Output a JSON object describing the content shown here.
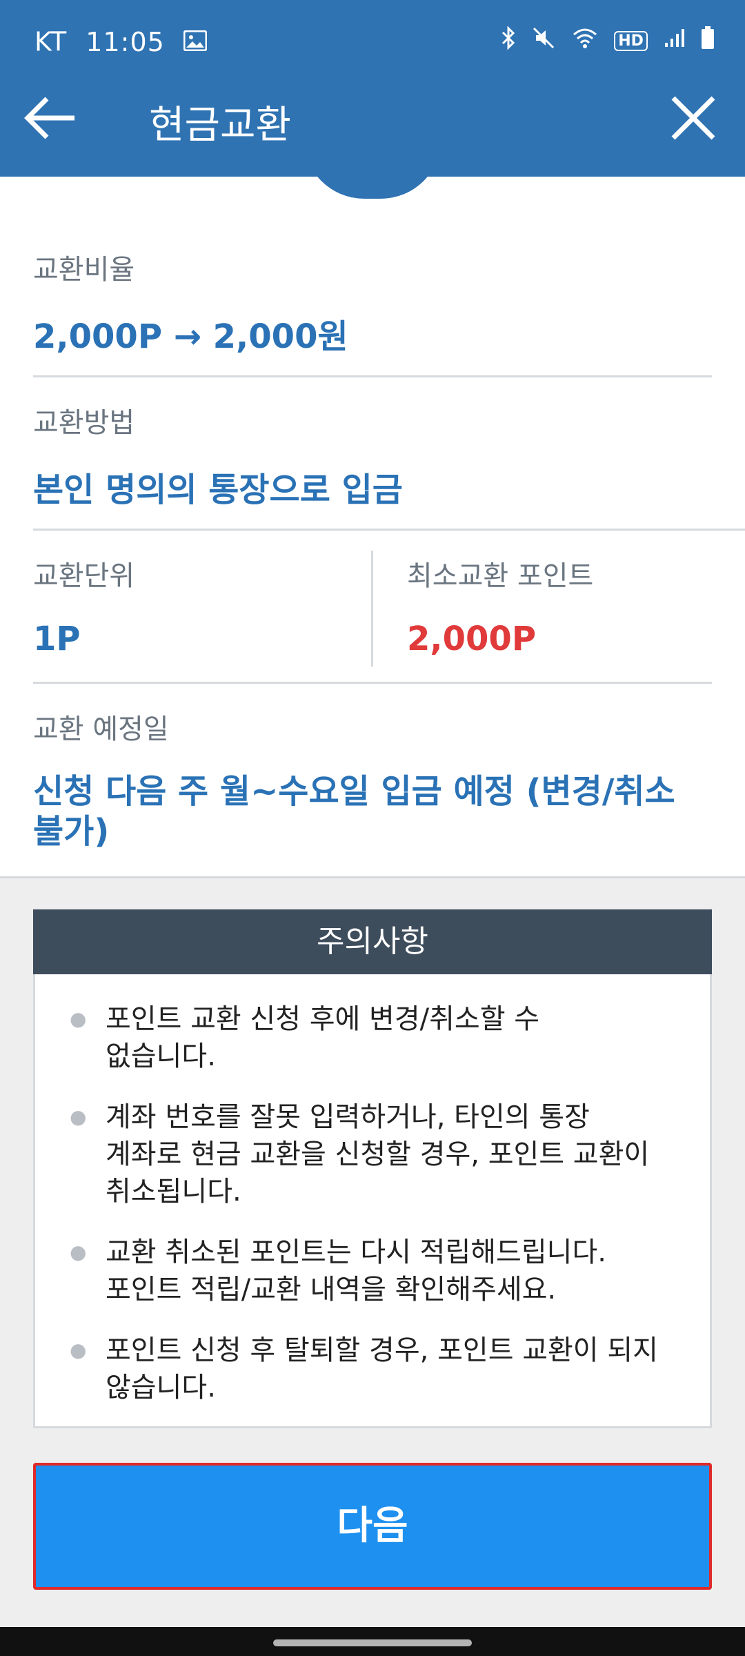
{
  "status": {
    "carrier": "KT",
    "time": "11:05",
    "icons": [
      "gallery-icon",
      "bluetooth-icon",
      "mute-icon",
      "wifi-icon",
      "hd-icon",
      "signal-icon",
      "battery-icon"
    ],
    "hd_label": "HD"
  },
  "header": {
    "title": "현금교환",
    "back_icon": "back-arrow-icon",
    "close_icon": "close-icon",
    "color": "#2f73b3"
  },
  "info": {
    "rate_label": "교환비율",
    "rate_value": "2,000P → 2,000원",
    "method_label": "교환방법",
    "method_value": "본인 명의의 통장으로 입금",
    "unit_label": "교환단위",
    "unit_value": "1P",
    "min_label": "최소교환 포인트",
    "min_value": "2,000P",
    "date_label": "교환 예정일",
    "date_value_line1": "신청 다음 주 월~수요일 입금 예정 (변경/취소",
    "date_value_line2": "불가)"
  },
  "notice": {
    "title": "주의사항",
    "items": [
      {
        "line1": "포인트 교환 신청 후에 변경/취소할 수",
        "line2": "없습니다.",
        "line3": ""
      },
      {
        "line1": "계좌 번호를 잘못 입력하거나, 타인의 통장",
        "line2": "계좌로 현금 교환을 신청할 경우, 포인트 교환이",
        "line3": "취소됩니다."
      },
      {
        "line1": "교환 취소된 포인트는 다시 적립해드립니다.",
        "line2": "포인트 적립/교환 내역을 확인해주세요.",
        "line3": ""
      },
      {
        "line1": "포인트 신청 후 탈퇴할 경우, 포인트 교환이 되지",
        "line2": "않습니다.",
        "line3": ""
      }
    ]
  },
  "button": {
    "next_label": "다음",
    "color": "#1e90ef"
  },
  "colors": {
    "value_blue": "#2a72b5",
    "value_red": "#e03a3a"
  }
}
